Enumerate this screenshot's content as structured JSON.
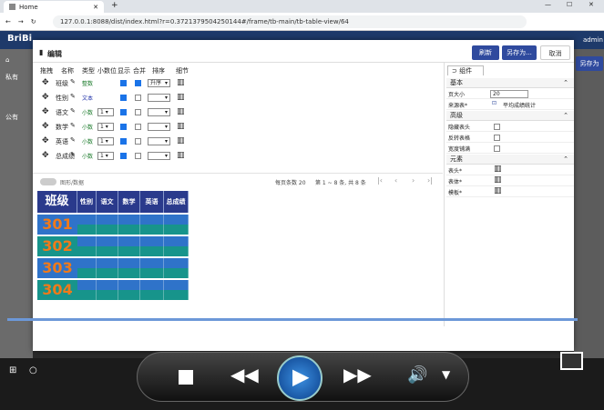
{
  "browser": {
    "tab_title": "Home",
    "url": "127.0.0.1:8088/dist/index.html?r=0.37213795042501​44#/frame/tb-main/tb-table-view/64"
  },
  "app": {
    "brand": "BriBi",
    "user": "admin",
    "nav": [
      "私有",
      "公有"
    ],
    "right_action": "另存为"
  },
  "dialog": {
    "title": "编辑",
    "buttons": {
      "refresh": "刷新",
      "save_as": "另存为...",
      "cancel": "取消"
    },
    "field_headers": [
      "拖拽",
      "名称",
      "类型",
      "小数位",
      "显示",
      "合并",
      "排序",
      "细节"
    ],
    "fields": [
      {
        "name": "班级",
        "type": "整数",
        "decimal": "",
        "show": true,
        "merge": true,
        "sort": "升序"
      },
      {
        "name": "性别",
        "type": "文本",
        "decimal": "",
        "show": true,
        "merge": false,
        "sort": ""
      },
      {
        "name": "语文",
        "type": "小数",
        "decimal": "1",
        "show": true,
        "merge": false,
        "sort": ""
      },
      {
        "name": "数学",
        "type": "小数",
        "decimal": "1",
        "show": true,
        "merge": false,
        "sort": ""
      },
      {
        "name": "英语",
        "type": "小数",
        "decimal": "1",
        "show": true,
        "merge": false,
        "sort": ""
      },
      {
        "name": "总成绩",
        "type": "小数",
        "decimal": "1",
        "show": true,
        "merge": false,
        "sort": ""
      }
    ],
    "toggle_label": "图形/数据",
    "pager": {
      "page_size": "每页条数 20",
      "range": "第 1 ~ 8 条, 共 8 条"
    },
    "report": {
      "headers": [
        "班级",
        "性别",
        "语文",
        "数学",
        "英语",
        "总成绩"
      ],
      "classes": [
        "301",
        "302",
        "303",
        "304"
      ],
      "header_color": "#2a3a8c",
      "class_color": "#f07a1a",
      "row_colors": [
        "#2f73c9",
        "#17948b"
      ]
    },
    "panel": {
      "tab": "组件",
      "sections": [
        {
          "title": "基本",
          "rows": [
            {
              "label": "页大小",
              "value": "20"
            },
            {
              "label": "来源表*",
              "value": "平均成绩统计"
            }
          ]
        },
        {
          "title": "高级",
          "rows": [
            {
              "label": "隐藏表头",
              "value": ""
            },
            {
              "label": "反转表格",
              "value": ""
            },
            {
              "label": "宽度铺满",
              "value": ""
            }
          ]
        },
        {
          "title": "元素",
          "rows": [
            {
              "label": "表头*",
              "value": ""
            },
            {
              "label": "表体*",
              "value": ""
            },
            {
              "label": "模板*",
              "value": ""
            }
          ]
        }
      ]
    }
  }
}
